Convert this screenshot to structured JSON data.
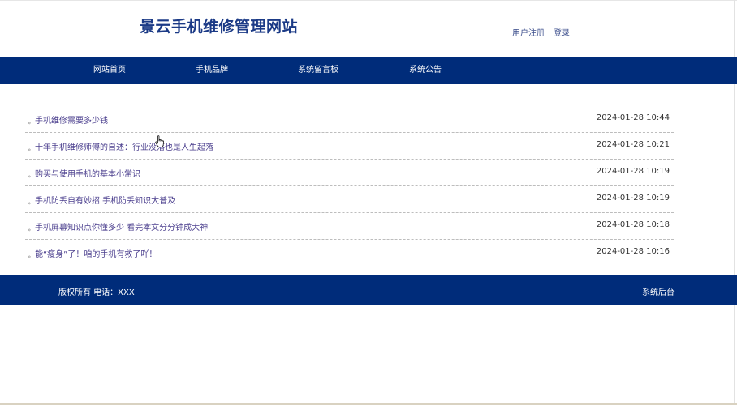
{
  "header": {
    "site_title": "景云手机维修管理网站",
    "register_label": "用户注册",
    "login_label": "登录"
  },
  "nav": {
    "items": [
      {
        "label": "网站首页"
      },
      {
        "label": "手机品牌"
      },
      {
        "label": "系统留言板"
      },
      {
        "label": "系统公告"
      }
    ]
  },
  "news": {
    "bullet": "»",
    "rows": [
      {
        "title": "手机维修需要多少钱",
        "date": "2024-01-28 10:44"
      },
      {
        "title": "十年手机维修师傅的自述：行业没落也是人生起落",
        "date": "2024-01-28 10:21"
      },
      {
        "title": "购买与使用手机的基本小常识",
        "date": "2024-01-28 10:19"
      },
      {
        "title": "手机防丢自有妙招 手机防丢知识大普及",
        "date": "2024-01-28 10:19"
      },
      {
        "title": "手机屏幕知识点你懂多少 看完本文分分钟成大神",
        "date": "2024-01-28 10:18"
      },
      {
        "title": "能“瘦身”了！咱的手机有救了吖！",
        "date": "2024-01-28 10:16"
      }
    ]
  },
  "footer": {
    "copyright": "版权所有 电话：XXX",
    "admin_label": "系统后台"
  },
  "colors": {
    "brand_navy": "#002c7a",
    "title_blue": "#1b3a86",
    "link_purple": "#4b3f8e"
  }
}
